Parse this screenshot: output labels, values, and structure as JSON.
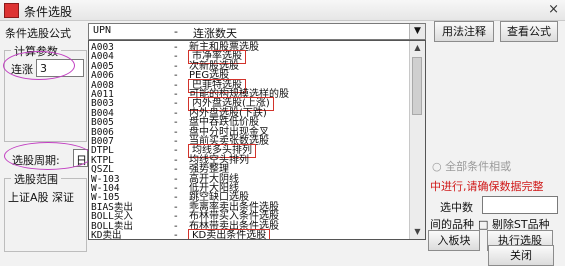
{
  "window": {
    "title": "条件选股",
    "close": "×"
  },
  "formula_label": "条件选股公式",
  "combo": {
    "code": "UPN",
    "dash": "-",
    "name": "连涨数天"
  },
  "buttons": {
    "usage": "用法注释",
    "view_formula": "查看公式",
    "add_board": "入板块",
    "execute": "执行选股",
    "close": "关闭"
  },
  "params_group": "计算参数",
  "param_label": "连涨",
  "param_value": "3",
  "period_label": "选股周期:",
  "period_value": "日",
  "range_group": "选股范围",
  "range_value": "上证A股 深证",
  "right_hint": "全部条件相或",
  "progress_text": "中进行,请确保数据完整",
  "selected_label": "选中数",
  "chk_time_varieties": "间的品种",
  "chk_exclude_st": "剔除ST品种",
  "icons": {
    "radio": "radio-circle-icon",
    "checkbox": "checkbox-icon",
    "dropdown": "chevron-down-icon"
  },
  "highlight_color": "#d2332b",
  "annotation_color": "#c23fc2",
  "dropdown_items": [
    {
      "code": "A003",
      "name": "新主和股票选股",
      "highlight": false
    },
    {
      "code": "A004",
      "name": "市净率选股",
      "highlight": true
    },
    {
      "code": "A005",
      "name": "次新股选股",
      "highlight": false
    },
    {
      "code": "A006",
      "name": "PEG选股",
      "highlight": false
    },
    {
      "code": "A008",
      "name": "巴菲特选股",
      "highlight": true
    },
    {
      "code": "A011",
      "name": "可能的构规模选样的股",
      "highlight": false
    },
    {
      "code": "B003",
      "name": "内外盘选股(上涨)",
      "highlight": true
    },
    {
      "code": "B004",
      "name": "内外盘选股(下跌)",
      "highlight": false
    },
    {
      "code": "B005",
      "name": "盘中吞跌低价股",
      "highlight": false
    },
    {
      "code": "B006",
      "name": "盘中分时出现金叉",
      "highlight": false
    },
    {
      "code": "B007",
      "name": "当前买卖张数选股",
      "highlight": false
    },
    {
      "code": "DTPL",
      "name": "均线多头排列",
      "highlight": true
    },
    {
      "code": "KTPL",
      "name": "均线空头排列",
      "highlight": false
    },
    {
      "code": "QSZL",
      "name": "强势整理",
      "highlight": false
    },
    {
      "code": "W-103",
      "name": "高开大阴线",
      "highlight": false
    },
    {
      "code": "W-104",
      "name": "低开大阳线",
      "highlight": false
    },
    {
      "code": "W-105",
      "name": "跳空缺口选股",
      "highlight": false
    },
    {
      "code": "BIAS卖出",
      "name": "乖离率卖出条件选股",
      "highlight": false
    },
    {
      "code": "BOLL买入",
      "name": "布林带买入条件选股",
      "highlight": false
    },
    {
      "code": "BOLL卖出",
      "name": "布林带卖出条件选股",
      "highlight": false
    },
    {
      "code": "KD卖出",
      "name": "KD卖出条件选股",
      "highlight": true
    }
  ]
}
